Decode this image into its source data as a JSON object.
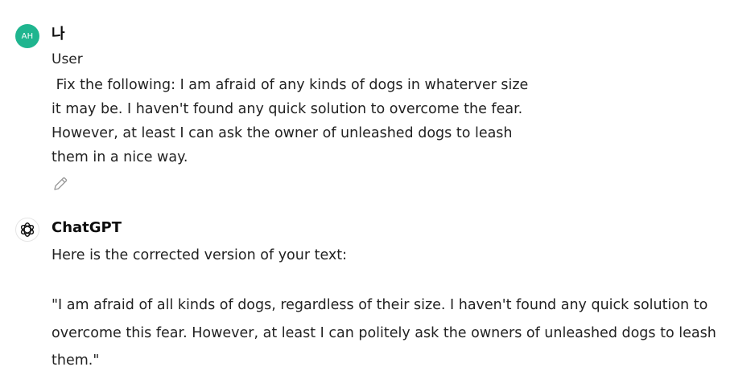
{
  "user_message": {
    "avatar_initials": "AH",
    "avatar_color": "#1fb58f",
    "display_name": "나",
    "role_label": "User",
    "text": " Fix the following: I am afraid of any kinds of dogs in whaterver size\nit may be. I haven't found any quick solution to overcome the fear.\nHowever, at least I can ask the owner of unleashed dogs to leash\nthem in a nice way.",
    "edit_icon": "pencil-icon"
  },
  "assistant_message": {
    "avatar_icon": "openai-logo-icon",
    "name": "ChatGPT",
    "intro": "Here is the corrected version of your text:",
    "quote": "\"I am afraid of all kinds of dogs, regardless of their size. I haven't found any quick solution to overcome this fear. However, at least I can politely ask the owners of unleashed dogs to leash them.\""
  }
}
